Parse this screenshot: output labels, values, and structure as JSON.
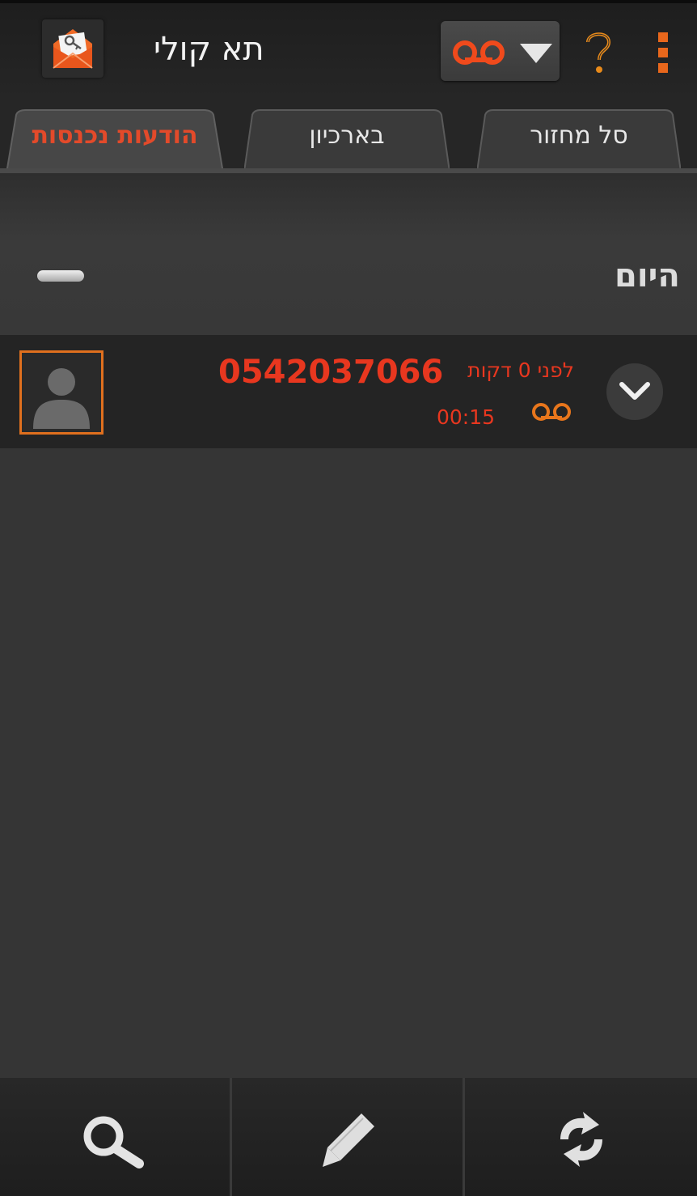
{
  "app": {
    "title": "תא קולי",
    "logo_icon": "envelope-key-icon"
  },
  "toolbar": {
    "filter_icon": "voicemail-icon",
    "dropdown_icon": "chevron-down-icon",
    "help_icon": "question-icon",
    "menu_icon": "overflow-menu-icon"
  },
  "tabs": [
    {
      "label": "הודעות נכנסות",
      "active": true
    },
    {
      "label": "בארכיון",
      "active": false
    },
    {
      "label": "סל מחזור",
      "active": false
    }
  ],
  "section": {
    "label": "היום"
  },
  "messages": [
    {
      "number": "0542037066",
      "time_ago": "לפני 0 דקות",
      "duration": "00:15",
      "type_icon": "voicemail-icon",
      "avatar_icon": "person-icon"
    }
  ],
  "bottom_bar": {
    "buttons": [
      "search-icon",
      "pencil-icon",
      "refresh-icon"
    ]
  },
  "colors": {
    "accent": "#e8371f",
    "orange": "#e0701e",
    "background": "#353535",
    "bar": "#242424"
  }
}
